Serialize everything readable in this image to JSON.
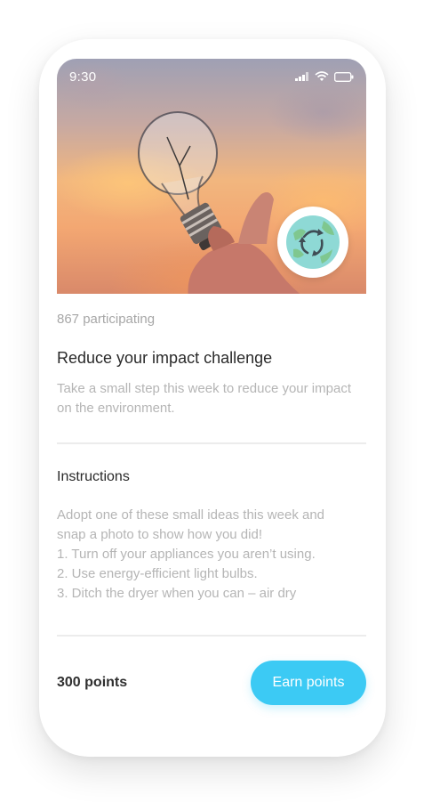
{
  "status_bar": {
    "time": "9:30",
    "icons": [
      "signal-icon",
      "wifi-icon",
      "battery-icon"
    ]
  },
  "challenge": {
    "participants": "867 participating",
    "title": "Reduce your impact challenge",
    "description": "Take a small step this week to reduce your impact on the environment.",
    "badge_icon": "recycle-earth-icon"
  },
  "instructions": {
    "heading": "Instructions",
    "lines": [
      "Adopt one of these small ideas this week and",
      "snap a photo to show how you did!",
      "1. Turn off your appliances you aren’t using.",
      "2. Use energy-efficient light bulbs.",
      "3. Ditch the dryer when you can – air dry"
    ]
  },
  "footer": {
    "points": "300 points",
    "earn_button": "Earn points"
  },
  "colors": {
    "accent": "#3ccaf4",
    "muted_text": "#b5b5b5",
    "divider": "#ececec"
  }
}
